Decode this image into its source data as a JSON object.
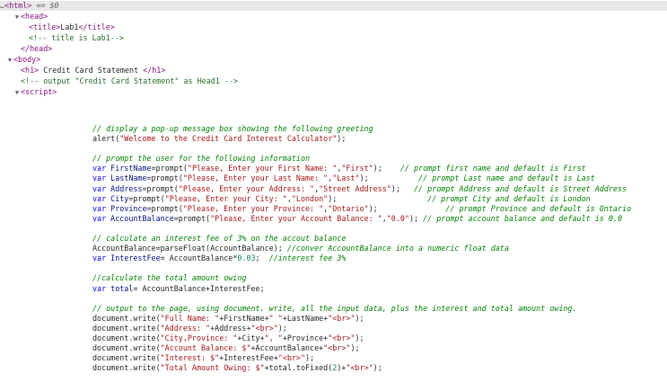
{
  "dom": {
    "html_line": {
      "dots": "…",
      "open": "<html>",
      "eq": "==",
      "ref": "$0"
    },
    "head_open": "<head>",
    "title_open": "<title>",
    "title_text": "Lab1",
    "title_close": "</title>",
    "comment_title": "<!-- title is Lab1-->",
    "head_close": "</head>",
    "body_open": "<body>",
    "h1_open": "<h1>",
    "h1_text": " Credit Card Statement ",
    "h1_close": "</h1>",
    "comment_h1": "<!-- output \"Credit Card Statement\" as Head1 -->",
    "script_open": "<script>"
  },
  "script_lines": {
    "l01": "// display a pop-up message box showing the following greeting",
    "l02a": "alert(",
    "l02b": "\"Welcome to the Credit Card Interest Calculator\"",
    "l02c": ");",
    "l03": "// prompt the user for the following information",
    "l04a": "var ",
    "l04b": "FirstName",
    "l04c": "=prompt(",
    "l04d": "\"Please, Enter your First Name: \"",
    "l04e": ",",
    "l04f": "\"First\"",
    "l04g": ");    ",
    "l04h": "// prompt first name and default is First",
    "l05a": "var ",
    "l05b": "LastName",
    "l05c": "=prompt(",
    "l05d": "\"Please, Enter your Last Name: \"",
    "l05e": ",",
    "l05f": "\"Last\"",
    "l05g": ");           ",
    "l05h": "// prompt Last name and default is Last",
    "l06a": "var ",
    "l06b": "Address",
    "l06c": "=prompt(",
    "l06d": "\"Please, Enter your Address: \"",
    "l06e": ",",
    "l06f": "\"Street Address\"",
    "l06g": ");   ",
    "l06h": "// prompt Address and default is Street Address",
    "l07a": "var ",
    "l07b": "City",
    "l07c": "=prompt(",
    "l07d": "\"Please, Enter your City: \"",
    "l07e": ",",
    "l07f": "\"London\"",
    "l07g": ");                    ",
    "l07h": "// prompt City and default is London",
    "l08a": "var ",
    "l08b": "Province",
    "l08c": "=prompt(",
    "l08d": "\"Please, Enter your Province: \"",
    "l08e": ",",
    "l08f": "\"Ontario\"",
    "l08g": ");               ",
    "l08h": "// prompt Province and default is Ontario",
    "l09a": "var ",
    "l09b": "AccountBalance",
    "l09c": "=prompt(",
    "l09d": "\"Please, Enter your Account Balance: \"",
    "l09e": ",",
    "l09f": "\"0.0\"",
    "l09g": "); ",
    "l09h": "// prompt account balance and default is 0.0",
    "l10": "// calculate an interest fee of 3% on the accout balance",
    "l11a": "AccountBalance=parseFloat(AccountBalance); ",
    "l11b": "//conver AccountBalance into a numeric float data",
    "l12a": "var ",
    "l12b": "InterestFee",
    "l12c": "= AccountBalance*",
    "l12d": "0.03",
    "l12e": ";  ",
    "l12f": "//interest fee 3%",
    "l13": "//calculate the total amount owing",
    "l14a": "var ",
    "l14b": "total",
    "l14c": "= AccountBalance+InterestFee;",
    "l15": "// output to the page, using document. write, all the input data, plus the interest and total amount owing.",
    "l16a": "document.write(",
    "l16b": "\"Full Name: \"",
    "l16c": "+FirstName+",
    "l16d": "\" \"",
    "l16e": "+LastName+",
    "l16f": "\"<br>\"",
    "l16g": ");",
    "l17a": "document.write(",
    "l17b": "\"Address: \"",
    "l17c": "+Address+",
    "l17d": "\"<br>\"",
    "l17e": ");",
    "l18a": "document.write(",
    "l18b": "\"City,Province: \"",
    "l18c": "+City+",
    "l18d": "\", \"",
    "l18e": "+Province+",
    "l18f": "\"<br>\"",
    "l18g": ");",
    "l19a": "document.write(",
    "l19b": "\"Account Balance: $\"",
    "l19c": "+AccountBalance+",
    "l19d": "\"<br>\"",
    "l19e": ");",
    "l20a": "document.write(",
    "l20b": "\"Interest: $\"",
    "l20c": "+InterestFee+",
    "l20d": "\"<br>\"",
    "l20e": ");",
    "l21a": "document.write(",
    "l21b": "\"Total Amount Owing: $\"",
    "l21c": "+total.toFixed(",
    "l21d": "2",
    "l21e": ")+",
    "l21f": "\"<br>\"",
    "l21g": ");"
  },
  "colors": {
    "tag": "#881280",
    "comment": "#236e25",
    "keyword": "#0000ff",
    "string": "#a31515",
    "number": "#098658",
    "js_comment": "#008000",
    "selected_row": "#e8e8e8"
  },
  "icons": [
    "expand-triangle-icon"
  ]
}
